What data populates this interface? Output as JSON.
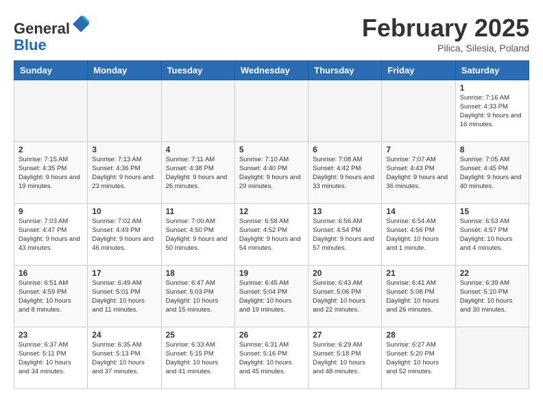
{
  "header": {
    "logo_general": "General",
    "logo_blue": "Blue",
    "month_title": "February 2025",
    "location": "Pilica, Silesia, Poland"
  },
  "weekdays": [
    "Sunday",
    "Monday",
    "Tuesday",
    "Wednesday",
    "Thursday",
    "Friday",
    "Saturday"
  ],
  "weeks": [
    [
      {
        "day": "",
        "info": ""
      },
      {
        "day": "",
        "info": ""
      },
      {
        "day": "",
        "info": ""
      },
      {
        "day": "",
        "info": ""
      },
      {
        "day": "",
        "info": ""
      },
      {
        "day": "",
        "info": ""
      },
      {
        "day": "1",
        "info": "Sunrise: 7:16 AM\nSunset: 4:33 PM\nDaylight: 9 hours and 16 minutes."
      }
    ],
    [
      {
        "day": "2",
        "info": "Sunrise: 7:15 AM\nSunset: 4:35 PM\nDaylight: 9 hours and 19 minutes."
      },
      {
        "day": "3",
        "info": "Sunrise: 7:13 AM\nSunset: 4:36 PM\nDaylight: 9 hours and 23 minutes."
      },
      {
        "day": "4",
        "info": "Sunrise: 7:11 AM\nSunset: 4:38 PM\nDaylight: 9 hours and 26 minutes."
      },
      {
        "day": "5",
        "info": "Sunrise: 7:10 AM\nSunset: 4:40 PM\nDaylight: 9 hours and 29 minutes."
      },
      {
        "day": "6",
        "info": "Sunrise: 7:08 AM\nSunset: 4:42 PM\nDaylight: 9 hours and 33 minutes."
      },
      {
        "day": "7",
        "info": "Sunrise: 7:07 AM\nSunset: 4:43 PM\nDaylight: 9 hours and 36 minutes."
      },
      {
        "day": "8",
        "info": "Sunrise: 7:05 AM\nSunset: 4:45 PM\nDaylight: 9 hours and 40 minutes."
      }
    ],
    [
      {
        "day": "9",
        "info": "Sunrise: 7:03 AM\nSunset: 4:47 PM\nDaylight: 9 hours and 43 minutes."
      },
      {
        "day": "10",
        "info": "Sunrise: 7:02 AM\nSunset: 4:49 PM\nDaylight: 9 hours and 46 minutes."
      },
      {
        "day": "11",
        "info": "Sunrise: 7:00 AM\nSunset: 4:50 PM\nDaylight: 9 hours and 50 minutes."
      },
      {
        "day": "12",
        "info": "Sunrise: 6:58 AM\nSunset: 4:52 PM\nDaylight: 9 hours and 54 minutes."
      },
      {
        "day": "13",
        "info": "Sunrise: 6:56 AM\nSunset: 4:54 PM\nDaylight: 9 hours and 57 minutes."
      },
      {
        "day": "14",
        "info": "Sunrise: 6:54 AM\nSunset: 4:56 PM\nDaylight: 10 hours and 1 minute."
      },
      {
        "day": "15",
        "info": "Sunrise: 6:53 AM\nSunset: 4:57 PM\nDaylight: 10 hours and 4 minutes."
      }
    ],
    [
      {
        "day": "16",
        "info": "Sunrise: 6:51 AM\nSunset: 4:59 PM\nDaylight: 10 hours and 8 minutes."
      },
      {
        "day": "17",
        "info": "Sunrise: 6:49 AM\nSunset: 5:01 PM\nDaylight: 10 hours and 11 minutes."
      },
      {
        "day": "18",
        "info": "Sunrise: 6:47 AM\nSunset: 5:03 PM\nDaylight: 10 hours and 15 minutes."
      },
      {
        "day": "19",
        "info": "Sunrise: 6:45 AM\nSunset: 5:04 PM\nDaylight: 10 hours and 19 minutes."
      },
      {
        "day": "20",
        "info": "Sunrise: 6:43 AM\nSunset: 5:06 PM\nDaylight: 10 hours and 22 minutes."
      },
      {
        "day": "21",
        "info": "Sunrise: 6:41 AM\nSunset: 5:08 PM\nDaylight: 10 hours and 26 minutes."
      },
      {
        "day": "22",
        "info": "Sunrise: 6:39 AM\nSunset: 5:10 PM\nDaylight: 10 hours and 30 minutes."
      }
    ],
    [
      {
        "day": "23",
        "info": "Sunrise: 6:37 AM\nSunset: 5:11 PM\nDaylight: 10 hours and 34 minutes."
      },
      {
        "day": "24",
        "info": "Sunrise: 6:35 AM\nSunset: 5:13 PM\nDaylight: 10 hours and 37 minutes."
      },
      {
        "day": "25",
        "info": "Sunrise: 6:33 AM\nSunset: 5:15 PM\nDaylight: 10 hours and 41 minutes."
      },
      {
        "day": "26",
        "info": "Sunrise: 6:31 AM\nSunset: 5:16 PM\nDaylight: 10 hours and 45 minutes."
      },
      {
        "day": "27",
        "info": "Sunrise: 6:29 AM\nSunset: 5:18 PM\nDaylight: 10 hours and 48 minutes."
      },
      {
        "day": "28",
        "info": "Sunrise: 6:27 AM\nSunset: 5:20 PM\nDaylight: 10 hours and 52 minutes."
      },
      {
        "day": "",
        "info": ""
      }
    ]
  ]
}
